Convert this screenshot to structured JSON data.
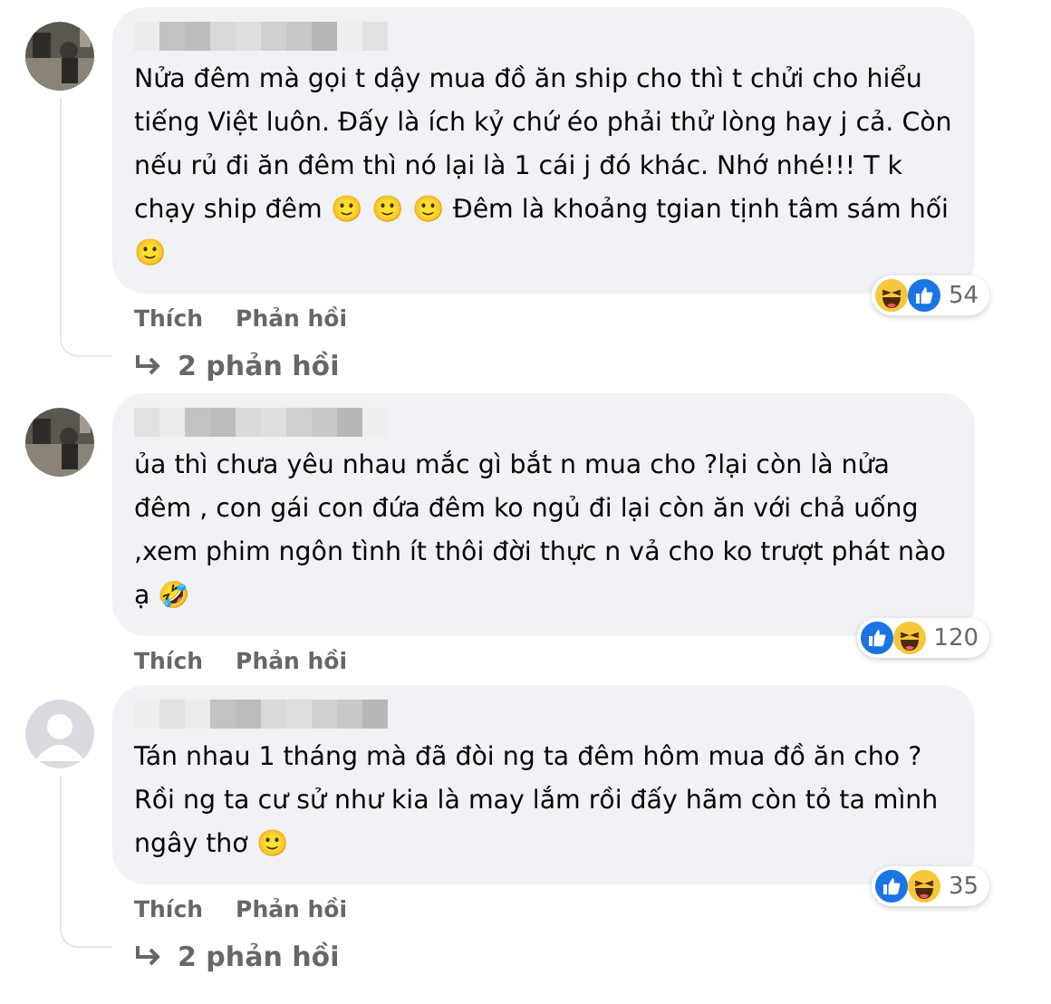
{
  "comments": [
    {
      "avatar": {
        "kind": "photo"
      },
      "text": "Nửa đêm mà gọi t dậy mua đồ ăn ship cho thì t chửi cho hiểu tiếng Việt luôn. Đấy là ích kỷ chứ éo phải thử lòng hay j cả. Còn nếu rủ đi ăn đêm thì nó lại là 1 cái j đó khác. Nhớ nhé!!! T k chạy ship đêm 🙂 🙂 🙂 Đêm là khoảng tgian tịnh tâm sám hối 🙂",
      "reactions": [
        {
          "kind": "haha"
        },
        {
          "kind": "like"
        }
      ],
      "reaction_count": "54",
      "actions": [
        "Thích",
        "Phản hồi"
      ],
      "replies": "2 phản hồi"
    },
    {
      "avatar": {
        "kind": "photo"
      },
      "text": "ủa thì chưa yêu nhau mắc gì bắt n mua cho ?lại còn là nửa đêm , con gái con đứa đêm ko ngủ đi lại còn ăn với chả uống ,xem phim ngôn tình ít thôi đời thực n vả cho ko trượt phát nào ạ 🤣",
      "reactions": [
        {
          "kind": "like"
        },
        {
          "kind": "haha"
        }
      ],
      "reaction_count": "120",
      "actions": [
        "Thích",
        "Phản hồi"
      ]
    },
    {
      "avatar": {
        "kind": "default"
      },
      "text": "Tán nhau 1 tháng mà đã đòi ng ta đêm hôm mua đồ ăn cho ? Rồi ng ta cư sử như kia là may lắm rồi đấy hãm còn tỏ ta mình ngây thơ 🙂",
      "reactions": [
        {
          "kind": "like"
        },
        {
          "kind": "haha"
        }
      ],
      "reaction_count": "35",
      "actions": [
        "Thích",
        "Phản hồi"
      ],
      "replies": "2 phản hồi"
    }
  ]
}
